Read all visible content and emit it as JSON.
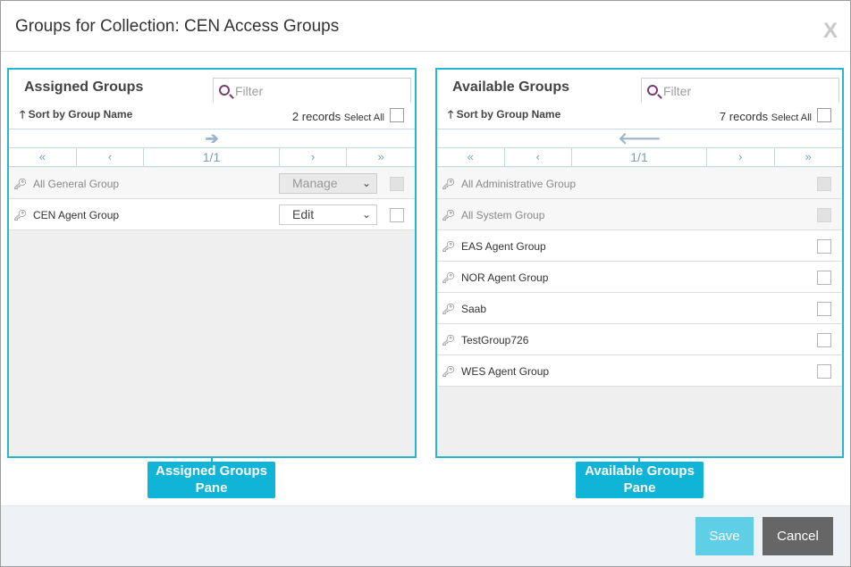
{
  "dialog": {
    "title": "Groups for Collection: CEN Access Groups",
    "close_label": "X"
  },
  "assigned": {
    "title": "Assigned Groups",
    "filter_placeholder": "Filter",
    "sort_label": "Sort by Group Name",
    "records": "2 records",
    "select_all": "Select All",
    "move_arrow": "➔",
    "pager": {
      "first": "«",
      "prev": "‹",
      "page": "1/1",
      "next": "›",
      "last": "»"
    },
    "rows": [
      {
        "name": "All General Group",
        "role": "Manage",
        "disabled": true
      },
      {
        "name": "CEN Agent Group",
        "role": "Edit",
        "disabled": false
      }
    ]
  },
  "available": {
    "title": "Available Groups",
    "filter_placeholder": "Filter",
    "sort_label": "Sort by Group Name",
    "records": "7 records",
    "select_all": "Select All",
    "move_arrow": "🡐",
    "pager": {
      "first": "«",
      "prev": "‹",
      "page": "1/1",
      "next": "›",
      "last": "»"
    },
    "rows": [
      {
        "name": "All Administrative Group",
        "disabled": true
      },
      {
        "name": "All System Group",
        "disabled": true
      },
      {
        "name": "EAS Agent Group",
        "disabled": false
      },
      {
        "name": "NOR Agent Group",
        "disabled": false
      },
      {
        "name": "Saab",
        "disabled": false
      },
      {
        "name": "TestGroup726",
        "disabled": false
      },
      {
        "name": "WES Agent Group",
        "disabled": false
      }
    ]
  },
  "callouts": {
    "assigned": "Assigned Groups Pane",
    "available": "Available Groups Pane"
  },
  "footer": {
    "save_label": "Save",
    "cancel_label": "Cancel"
  },
  "icons": {
    "group": "key-icon",
    "sort": "arrow-up-icon",
    "filter": "search-icon",
    "select": "chevron-down-icon"
  },
  "colors": {
    "accent": "#27b5cf",
    "callout": "#0fb4d6",
    "save": "#5fcfe8",
    "cancel": "#666666"
  }
}
